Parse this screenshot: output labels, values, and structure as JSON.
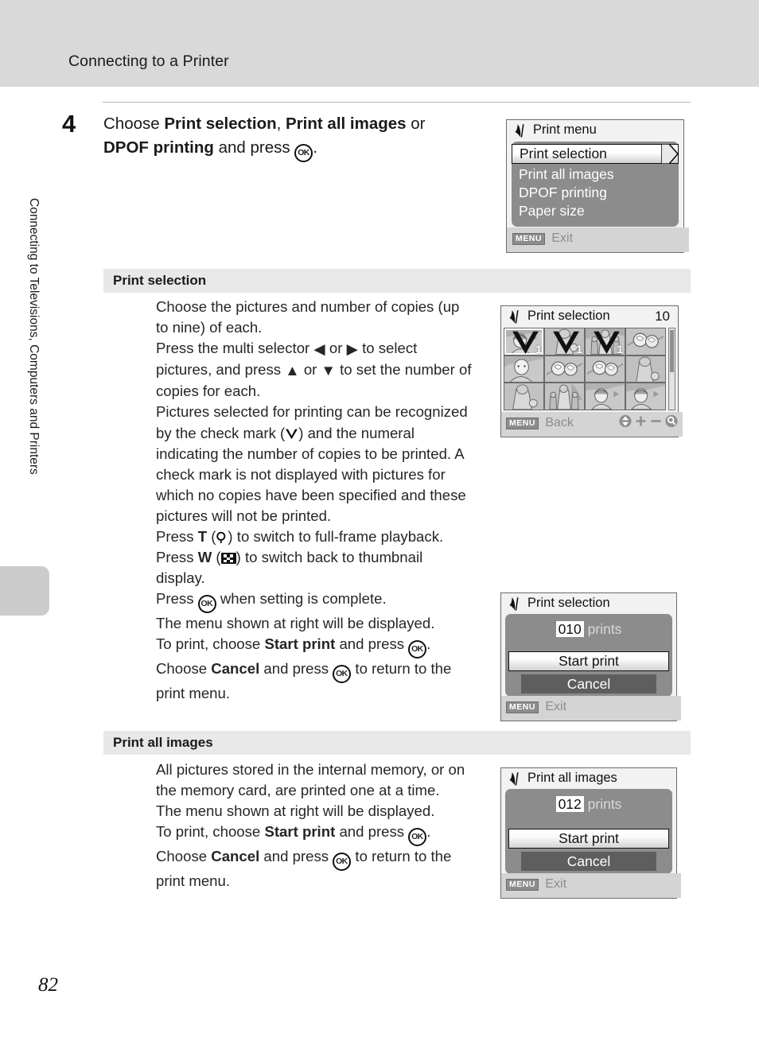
{
  "header": {
    "running_title": "Connecting to a Printer"
  },
  "side_tab": {
    "label": "Connecting to Televisions, Computers and Printers"
  },
  "page": {
    "number": "82"
  },
  "step": {
    "number": "4",
    "line1_prefix": "Choose ",
    "line1_bold1": "Print selection",
    "line1_mid": ", ",
    "line1_bold2": "Print all images",
    "line1_suffix": " or",
    "line2_bold": "DPOF printing",
    "line2_mid": " and press ",
    "line2_suffix": "."
  },
  "sections": [
    {
      "heading": "Print selection",
      "paragraphs": [
        "Choose the pictures and number of copies (up to nine) of each.",
        "Press the multi selector ◀ or ▶ to select pictures, and press ▲ or ▼ to set the number of copies for each.",
        "Pictures selected for printing can be recognized by the check mark (✔) and the numeral indicating the number of copies to be printed. A check mark is not displayed with pictures for which no copies have been specified and these pictures will not be printed.",
        "Press T (⚲) to switch to full-frame playback.",
        "Press W (▦) to switch back to thumbnail display.",
        "Press OK when setting is complete.",
        "The menu shown at right will be displayed.",
        "To print, choose Start print and press OK.",
        "Choose Cancel and press OK to return to the print menu."
      ]
    },
    {
      "heading": "Print all images",
      "paragraphs": [
        "All pictures stored in the internal memory, or on the memory card, are printed one at a time.",
        "The menu shown at right will be displayed.",
        "To print, choose Start print and press OK.",
        "Choose Cancel and press OK to return to the print menu."
      ]
    }
  ],
  "body_fragments": {
    "p1a": "Choose the pictures and number of copies (up",
    "p1b": "to nine) of each.",
    "p2a": "Press the multi selector ",
    "p2b": " or ",
    "p2c": " to select",
    "p2d": "pictures, and press ",
    "p2e": " or ",
    "p2f": " to set the number of",
    "p2g": "copies for each.",
    "p3a": "Pictures selected for printing can be recognized",
    "p3b": "by the check mark (",
    "p3c": ") and the numeral",
    "p3d": "indicating the number of copies to be printed. A",
    "p3e": "check mark is not displayed with pictures for",
    "p3f": "which no copies have been specified and these",
    "p3g": "pictures will not be printed.",
    "p4a": "Press ",
    "p4b": "T",
    "p4c": " (",
    "p4d": ") to switch to full-frame playback.",
    "p5a": "Press ",
    "p5b": "W",
    "p5c": " (",
    "p5d": ") to switch back to thumbnail",
    "p5e": "display.",
    "p6a": "Press ",
    "p6b": " when setting is complete.",
    "p7": "The menu shown at right will be displayed.",
    "p8a": "To print, choose ",
    "p8b": "Start print",
    "p8c": " and press ",
    "p8d": ".",
    "p9a": "Choose ",
    "p9b": "Cancel",
    "p9c": " and press ",
    "p9d": " to return to the",
    "p9e": "print menu.",
    "q1a": "All pictures stored in the internal memory, or on",
    "q1b": "the memory card, are printed one at a time.",
    "q2": "The menu shown at right will be displayed."
  },
  "screens": {
    "print_menu": {
      "title": "Print menu",
      "items": [
        {
          "label": "Print selection",
          "selected": true
        },
        {
          "label": "Print all images",
          "selected": false
        },
        {
          "label": "DPOF printing",
          "selected": false
        },
        {
          "label": "Paper size",
          "selected": false
        }
      ],
      "footer_badge": "MENU",
      "footer_label": "Exit"
    },
    "print_selection_grid": {
      "title": "Print selection",
      "count": "10",
      "footer_badge": "MENU",
      "footer_label": "Back",
      "thumbnails": [
        {
          "kind": "portrait-hat",
          "checked": true,
          "copies": "1",
          "current": true
        },
        {
          "kind": "figure-bag",
          "checked": true,
          "copies": "1",
          "current": false
        },
        {
          "kind": "two-people",
          "checked": true,
          "copies": "1",
          "current": false
        },
        {
          "kind": "flowers",
          "checked": false,
          "copies": "",
          "current": false
        },
        {
          "kind": "portrait-hat",
          "checked": false,
          "copies": "",
          "current": false
        },
        {
          "kind": "flowers",
          "checked": false,
          "copies": "",
          "current": false
        },
        {
          "kind": "flowers",
          "checked": false,
          "copies": "",
          "current": false
        },
        {
          "kind": "figure-bag",
          "checked": false,
          "copies": "",
          "current": false
        },
        {
          "kind": "figure-bag",
          "checked": false,
          "copies": "",
          "current": false
        },
        {
          "kind": "two-people",
          "checked": false,
          "copies": "",
          "current": false
        },
        {
          "kind": "portrait-hat",
          "checked": false,
          "copies": "",
          "current": false
        },
        {
          "kind": "portrait-hat",
          "checked": false,
          "copies": "",
          "current": false
        }
      ],
      "icons": [
        "updown-arrows-icon",
        "plus-icon",
        "minus-icon",
        "magnifier-icon"
      ]
    },
    "print_selection_dialog": {
      "title": "Print selection",
      "count_value": "010",
      "count_suffix": "prints",
      "start_label": "Start print",
      "cancel_label": "Cancel",
      "footer_badge": "MENU",
      "footer_label": "Exit"
    },
    "print_all_dialog": {
      "title": "Print all images",
      "count_value": "012",
      "count_suffix": "prints",
      "start_label": "Start print",
      "cancel_label": "Cancel",
      "footer_badge": "MENU",
      "footer_label": "Exit"
    }
  },
  "colors": {
    "header_band": "#d9d9d9",
    "section_bar": "#e8e8e8",
    "screen_panel": "#8c8c8c",
    "screen_bg": "#f2f2f2",
    "screen_border": "#6b6b6b",
    "footer_bar": "#d4d4d4",
    "cancel_band": "#5e5e5e"
  }
}
